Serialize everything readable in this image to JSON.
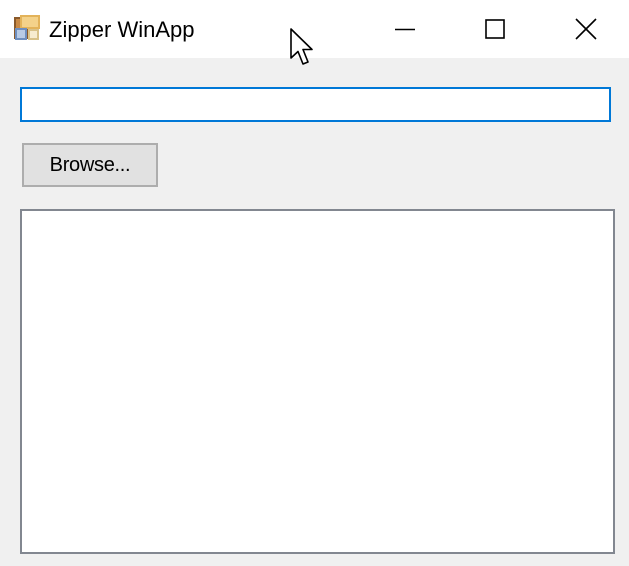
{
  "window": {
    "title": "Zipper WinApp",
    "app_icon": "zipper-app-icon",
    "caption_buttons": [
      {
        "name": "minimize",
        "icon": "minimize-icon"
      },
      {
        "name": "maximize",
        "icon": "maximize-icon"
      },
      {
        "name": "close",
        "icon": "close-icon"
      }
    ]
  },
  "form": {
    "path_input_value": "",
    "browse_label": "Browse...",
    "output_text": ""
  },
  "colors": {
    "title_bar": "#ffffff",
    "client_area": "#f0f0f0",
    "focus_border": "#0078d7",
    "button_face": "#e1e1e1",
    "button_border": "#adadad",
    "textbox_border": "#828790"
  }
}
